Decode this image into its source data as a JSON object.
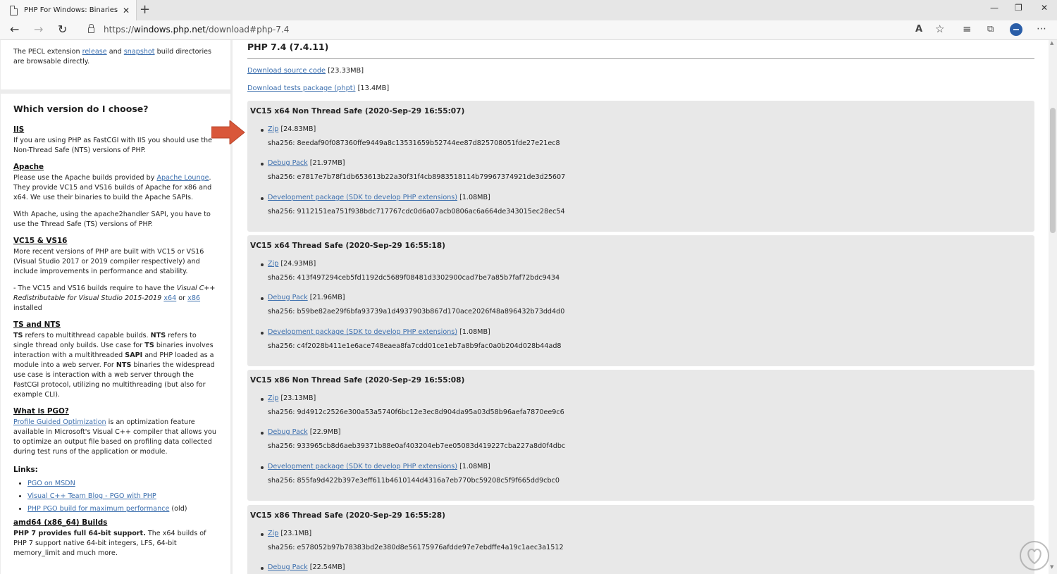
{
  "browser": {
    "tab_title": "PHP For Windows: Binaries and so",
    "tab_close": "✕",
    "new_tab": "+",
    "minimize": "—",
    "maximize": "❐",
    "close": "✕",
    "back": "←",
    "forward": "→",
    "reload": "↻",
    "url_prefix": "https://",
    "url_host": "windows.php.net",
    "url_path": "/download#php-7.4",
    "read_aloud": "A",
    "favorite": "☆",
    "favorites": "≡",
    "collections": "⧉",
    "menu": "⋯"
  },
  "sidebar": {
    "pecl": {
      "before": "The PECL extension ",
      "release": "release",
      "and": " and ",
      "snapshot": "snapshot",
      "after": " build directories are browsable directly."
    },
    "title": "Which version do I choose?",
    "iis": {
      "heading": "IIS",
      "text": "If you are using PHP as FastCGI with IIS you should use the Non-Thread Safe (NTS) versions of PHP."
    },
    "apache": {
      "heading": "Apache",
      "p1_before": "Please use the Apache builds provided by ",
      "p1_link": "Apache Lounge",
      "p1_after": ". They provide VC15 and VS16 builds of Apache for x86 and x64. We use their binaries to build the Apache SAPIs.",
      "p2": "With Apache, using the apache2handler SAPI, you have to use the Thread Safe (TS) versions of PHP."
    },
    "vc": {
      "heading": "VC15 & VS16",
      "p1": "More recent versions of PHP are built with VC15 or VS16 (Visual Studio 2017 or 2019 compiler respectively) and include improvements in performance and stability.",
      "p2_before": "- The VC15 and VS16 builds require to have the ",
      "p2_em": "Visual C++ Redistributable for Visual Studio 2015-2019",
      "p2_x64": "x64",
      "p2_or": " or ",
      "p2_x86": "x86",
      "p2_after": " installed"
    },
    "tsnts": {
      "heading": "TS and NTS",
      "t1": "TS",
      "t2": " refers to multithread capable builds. ",
      "t3": "NTS",
      "t4": " refers to single thread only builds. Use case for ",
      "t5": "TS",
      "t6": " binaries involves interaction with a multithreaded ",
      "t7": "SAPI",
      "t8": " and PHP loaded as a module into a web server. For ",
      "t9": "NTS",
      "t10": " binaries the widespread use case is interaction with a web server through the FastCGI protocol, utilizing no multithreading (but also for example CLI)."
    },
    "pgo": {
      "heading": "What is PGO?",
      "link": "Profile Guided Optimization",
      "text": " is an optimization feature available in Microsoft's Visual C++ compiler that allows you to optimize an output file based on profiling data collected during test runs of the application or module."
    },
    "links_label": "Links:",
    "links": [
      {
        "label": "PGO on MSDN",
        "suffix": ""
      },
      {
        "label": "Visual C++ Team Blog - PGO with PHP",
        "suffix": ""
      },
      {
        "label": "PHP PGO build for maximum performance",
        "suffix": " (old)"
      }
    ],
    "amd64": {
      "heading": "amd64 (x86_64) Builds",
      "bold": "PHP 7 provides full 64-bit support.",
      "text": " The x64 builds of PHP 7 support native 64-bit integers, LFS, 64-bit memory_limit and much more."
    }
  },
  "main": {
    "version_title": "PHP 7.4 (7.4.11)",
    "source_link": "Download source code",
    "source_size": " [23.33MB]",
    "tests_link": "Download tests package (phpt)",
    "tests_size": " [13.4MB]",
    "builds": [
      {
        "title": "VC15 x64 Non Thread Safe (2020-Sep-29 16:55:07)",
        "zip": "Zip",
        "zip_size": " [24.83MB]",
        "zip_sha": "sha256: 8eedaf90f087360ffe9449a8c13531659b52744ee87d825708051fde27e21ec8",
        "debug": "Debug Pack",
        "debug_size": " [21.97MB]",
        "debug_sha": "sha256: e7817e7b78f1db653613b22a30f31f4cb8983518114b79967374921de3d25607",
        "dev": "Development package (SDK to develop PHP extensions)",
        "dev_size": " [1.08MB]",
        "dev_sha": "sha256: 9112151ea751f938bdc717767cdc0d6a07acb0806ac6a664de343015ec28ec54"
      },
      {
        "title": "VC15 x64 Thread Safe (2020-Sep-29 16:55:18)",
        "zip": "Zip",
        "zip_size": " [24.93MB]",
        "zip_sha": "sha256: 413f497294ceb5fd1192dc5689f08481d3302900cad7be7a85b7faf72bdc9434",
        "debug": "Debug Pack",
        "debug_size": " [21.96MB]",
        "debug_sha": "sha256: b59be82ae29f6bfa93739a1d4937903b867d170ace2026f48a896432b73dd4d0",
        "dev": "Development package (SDK to develop PHP extensions)",
        "dev_size": " [1.08MB]",
        "dev_sha": "sha256: c4f2028b411e1e6ace748eaea8fa7cdd01ce1eb7a8b9fac0a0b204d028b44ad8"
      },
      {
        "title": "VC15 x86 Non Thread Safe (2020-Sep-29 16:55:08)",
        "zip": "Zip",
        "zip_size": " [23.13MB]",
        "zip_sha": "sha256: 9d4912c2526e300a53a5740f6bc12e3ec8d904da95a03d58b96aefa7870ee9c6",
        "debug": "Debug Pack",
        "debug_size": " [22.9MB]",
        "debug_sha": "sha256: 933965cb8d6aeb39371b88e0af403204eb7ee05083d419227cba227a8d0f4dbc",
        "dev": "Development package (SDK to develop PHP extensions)",
        "dev_size": " [1.08MB]",
        "dev_sha": "sha256: 855fa9d422b397e3eff611b4610144d4316a7eb770bc59208c5f9f665dd9cbc0"
      },
      {
        "title": "VC15 x86 Thread Safe (2020-Sep-29 16:55:28)",
        "zip": "Zip",
        "zip_size": " [23.1MB]",
        "zip_sha": "sha256: e578052b97b78383bd2e380d8e56175976afdde97e7ebdffe4a19c1aec3a1512",
        "debug": "Debug Pack",
        "debug_size": " [22.54MB]",
        "debug_sha": "",
        "dev": "",
        "dev_size": "",
        "dev_sha": ""
      }
    ]
  },
  "colors": {
    "link": "#3c6fae",
    "arrow": "#d9573a",
    "build_bg": "#e8e8e8",
    "sidebar_bg": "#ececec"
  },
  "icons": {
    "annotation": "red-arrow-icon",
    "watermark": "heart-logo-icon"
  }
}
